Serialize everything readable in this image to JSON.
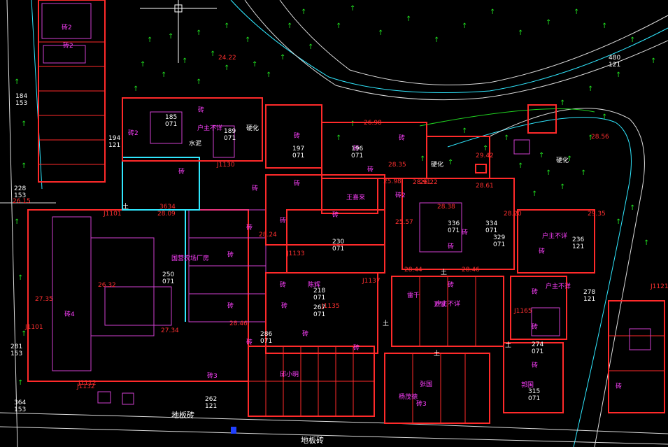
{
  "map": {
    "road_labels": [
      "地板砖",
      "地板砖"
    ],
    "material_labels": [
      "水泥",
      "硬化",
      "硬化",
      "硬化"
    ],
    "owner_labels": [
      "王喜来",
      "陈辉",
      "户主不详",
      "户主不详",
      "户主不详",
      "户主不详",
      "国营农场厂房",
      "雷千",
      "顶家",
      "邱小明",
      "张国",
      "杨茂德",
      "郭国"
    ],
    "building_tags": [
      "砖2",
      "砖2",
      "砖2",
      "砖2",
      "砖3",
      "砖3",
      "砖4",
      "砖",
      "砖",
      "砖",
      "砖",
      "砖",
      "砖",
      "砖",
      "砖",
      "砖",
      "砖",
      "砖",
      "砖",
      "砖",
      "砖",
      "砖",
      "砖",
      "砖",
      "砖",
      "砖",
      "砖",
      "砖",
      "砖",
      "砖",
      "砖",
      "砖",
      "砖"
    ],
    "parcel_codes": [
      "184\n153",
      "228\n153",
      "281\n153",
      "364\n153",
      "286\n071",
      "230\n071",
      "250\n071",
      "218\n071",
      "267\n071",
      "334\n071",
      "336\n071",
      "329\n071",
      "274\n071",
      "315\n071",
      "262\n121",
      "196\n071",
      "197\n071",
      "185\n071",
      "189\n071",
      "194\n121",
      "236\n121",
      "278\n121",
      "480\n121"
    ],
    "elevations": [
      "28.09",
      "26.15",
      "27.34",
      "28.24",
      "26.32",
      "27.35",
      "28.46",
      "28.38",
      "29.35",
      "25.98",
      "28.56",
      "28.44",
      "28.46",
      "29.42",
      "28.91",
      "28.61",
      "28.20",
      "24.22",
      "25.57",
      "28.35",
      "26.22",
      "26.98"
    ],
    "point_ids": [
      "3634",
      "J1130",
      "J1133",
      "J1135",
      "J1137",
      "J1121",
      "J1132",
      "J1165",
      "J1101",
      "J1101",
      "J1112"
    ],
    "ground_markers": [
      "土",
      "土",
      "土",
      "土",
      "土"
    ]
  }
}
